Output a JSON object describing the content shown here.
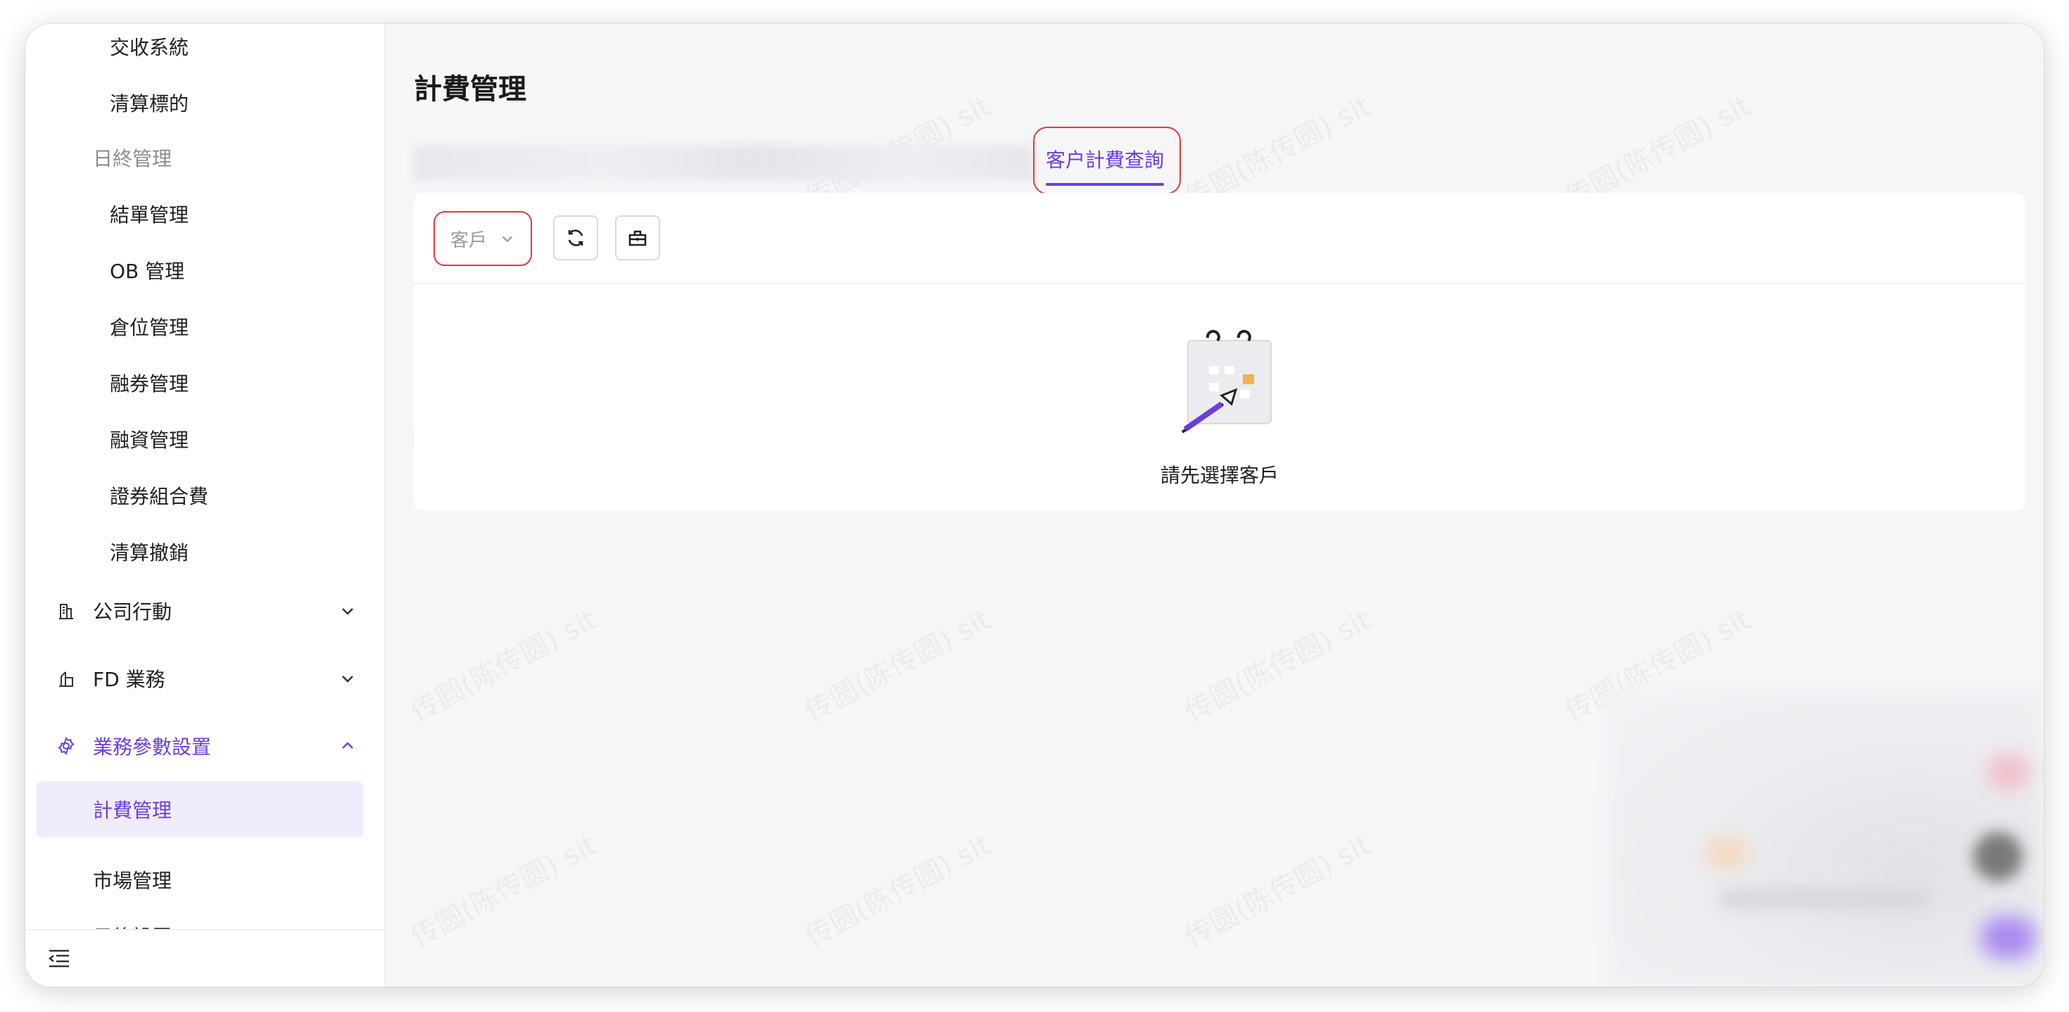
{
  "sidebar": {
    "items": [
      {
        "label": "交收系統"
      },
      {
        "label": "清算標的"
      },
      {
        "label": "日終管理"
      },
      {
        "label": "結單管理"
      },
      {
        "label": "OB 管理"
      },
      {
        "label": "倉位管理"
      },
      {
        "label": "融券管理"
      },
      {
        "label": "融資管理"
      },
      {
        "label": "證券組合費"
      },
      {
        "label": "清算撤銷"
      }
    ],
    "groups": [
      {
        "label": "公司行動",
        "icon": "building-icon",
        "expanded": false
      },
      {
        "label": "FD 業務",
        "icon": "bank-icon",
        "expanded": false
      },
      {
        "label": "業務參數設置",
        "icon": "settings-icon",
        "expanded": true
      }
    ],
    "sub_items": [
      {
        "label": "計費管理",
        "active": true
      },
      {
        "label": "市場管理"
      },
      {
        "label": "日終設置"
      }
    ]
  },
  "main": {
    "title": "計費管理",
    "active_tab": "客户計費查詢",
    "select_placeholder": "客戶",
    "empty_text": "請先選擇客戶",
    "watermark": "传圆(陈传圆) sit"
  },
  "colors": {
    "accent": "#6a3fd8",
    "highlight_border": "#e0393e",
    "active_bg": "#f1ecfd"
  }
}
